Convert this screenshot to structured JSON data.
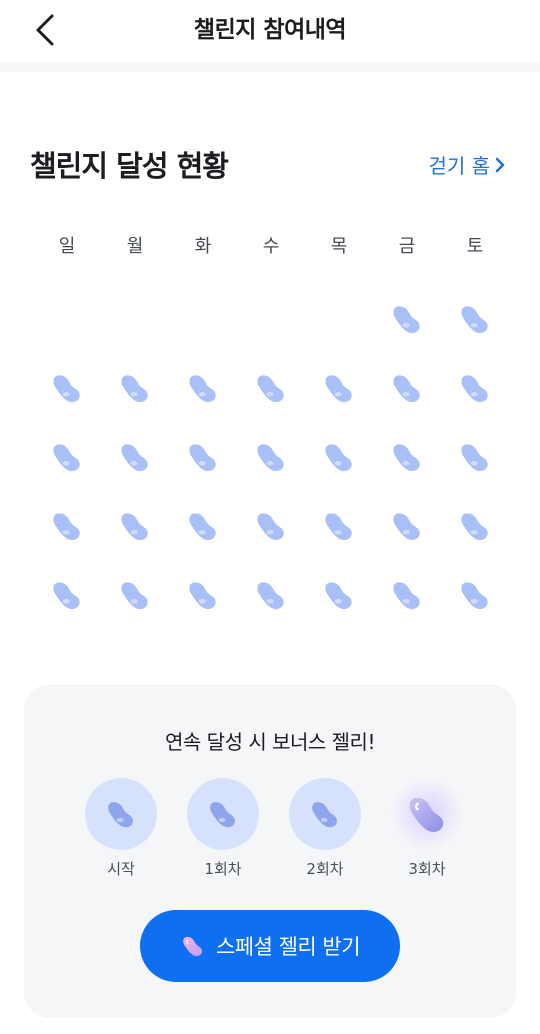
{
  "header": {
    "title": "챌린지 참여내역"
  },
  "section": {
    "title": "챌린지 달성 현황",
    "walk_home_label": "걷기 홈"
  },
  "calendar": {
    "weekdays": [
      "일",
      "월",
      "화",
      "수",
      "목",
      "금",
      "토"
    ],
    "rows": [
      [
        false,
        false,
        false,
        false,
        false,
        true,
        true
      ],
      [
        true,
        true,
        true,
        true,
        true,
        true,
        true
      ],
      [
        true,
        true,
        true,
        true,
        true,
        true,
        true
      ],
      [
        true,
        true,
        true,
        true,
        true,
        true,
        true
      ],
      [
        true,
        true,
        true,
        true,
        true,
        true,
        true
      ]
    ]
  },
  "bonus": {
    "title": "연속 달성 시 보너스 젤리!",
    "steps": [
      {
        "label": "시작",
        "state": "done"
      },
      {
        "label": "1회차",
        "state": "done"
      },
      {
        "label": "2회차",
        "state": "done"
      },
      {
        "label": "3회차",
        "state": "special"
      }
    ]
  },
  "special_button": {
    "label": "스페셜 젤리 받기"
  },
  "colors": {
    "accent": "#0e6ff0",
    "link": "#1f6fe0",
    "jelly": "#a9bff7",
    "step_bg": "#d6e2fb"
  }
}
